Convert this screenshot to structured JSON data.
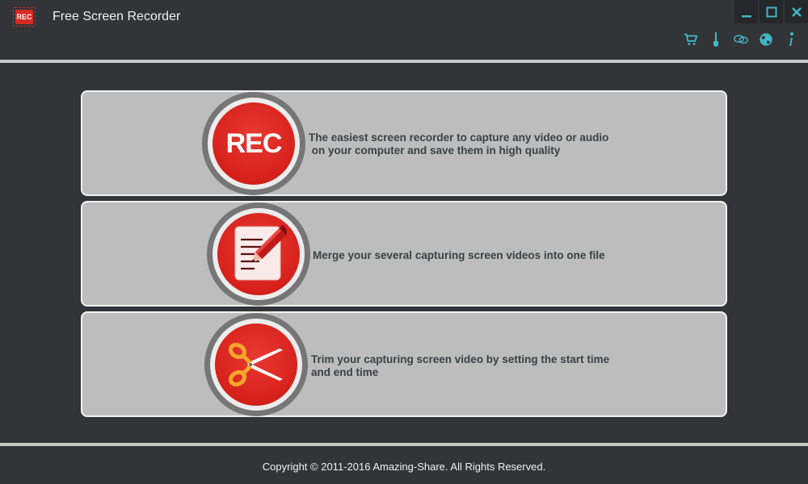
{
  "window": {
    "logo_text": "REC",
    "title": "Free Screen Recorder",
    "controls": [
      "minimize-icon",
      "maximize-icon",
      "close-icon"
    ],
    "accent_color": "#3fb8c6"
  },
  "toolbar": {
    "icons": [
      "cart-icon",
      "brush-icon",
      "chat-icon",
      "globe-icon",
      "info-icon"
    ]
  },
  "features": [
    {
      "badge_text": "REC",
      "icon": "rec-icon",
      "description": "The easiest screen recorder to capture any video or audio\n on your computer and save them in high quality"
    },
    {
      "icon": "merge-document-pencil-icon",
      "description": "Merge your several capturing screen videos into one file"
    },
    {
      "icon": "scissors-icon",
      "description": "Trim your capturing screen video by setting the start time\nand end time"
    }
  ],
  "footer": {
    "copyright": "Copyright © 2011-2016 Amazing-Share. All Rights Reserved."
  }
}
